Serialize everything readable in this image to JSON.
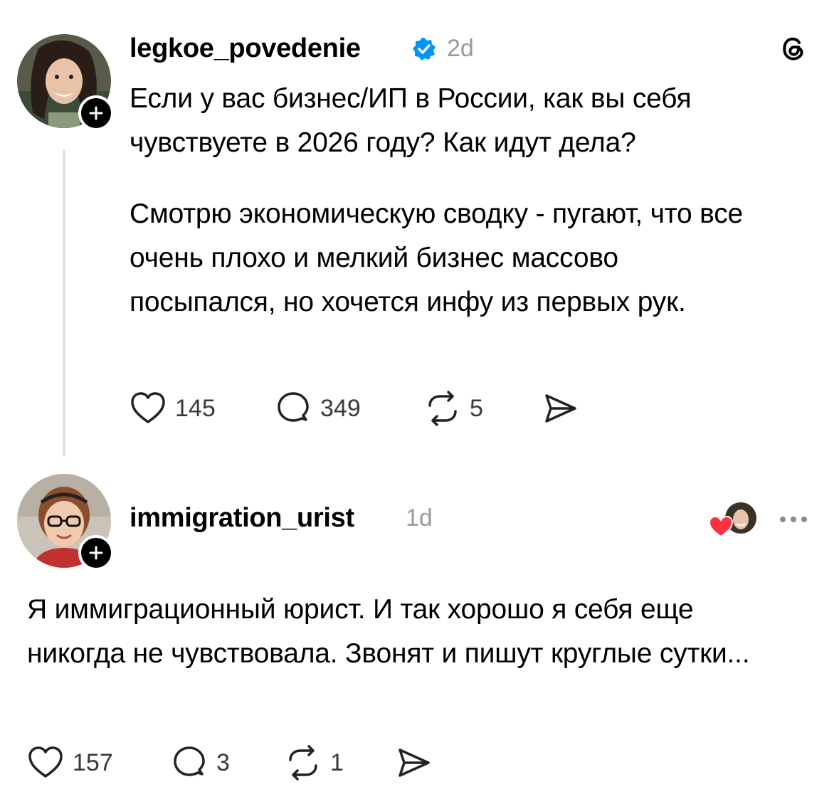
{
  "post": {
    "username": "legkoe_povedenіe",
    "time": "2d",
    "paragraph1": "Если у вас бизнес/ИП в России, как вы себя чувствуете в 2026 году? Как идут дела?",
    "paragraph2": "Смотрю экономическую сводку - пугают, что все очень плохо и мелкий бизнес массово посыпался, но хочется инфу из первых рук.",
    "likes": "145",
    "replies": "349",
    "reposts": "5"
  },
  "reply": {
    "username": "immigration_urist",
    "time": "1d",
    "text": "Я иммиграционный юрист. И так хорошо я себя еще никогда не чувствовала. Звонят и пишут круглые сутки...",
    "likes": "157",
    "replies": "3",
    "reposts": "1"
  },
  "icons": {
    "app_logo": "threads-logo-icon",
    "verified": "verified-badge-icon",
    "like": "heart-icon",
    "reply": "comment-bubble-icon",
    "repost": "repost-icon",
    "share": "send-icon",
    "follow": "plus-icon",
    "more": "more-dots-icon"
  },
  "colors": {
    "verified": "#0095f6",
    "liked_heart": "#ff3040",
    "text": "#000000",
    "muted": "#9a9a9a"
  }
}
